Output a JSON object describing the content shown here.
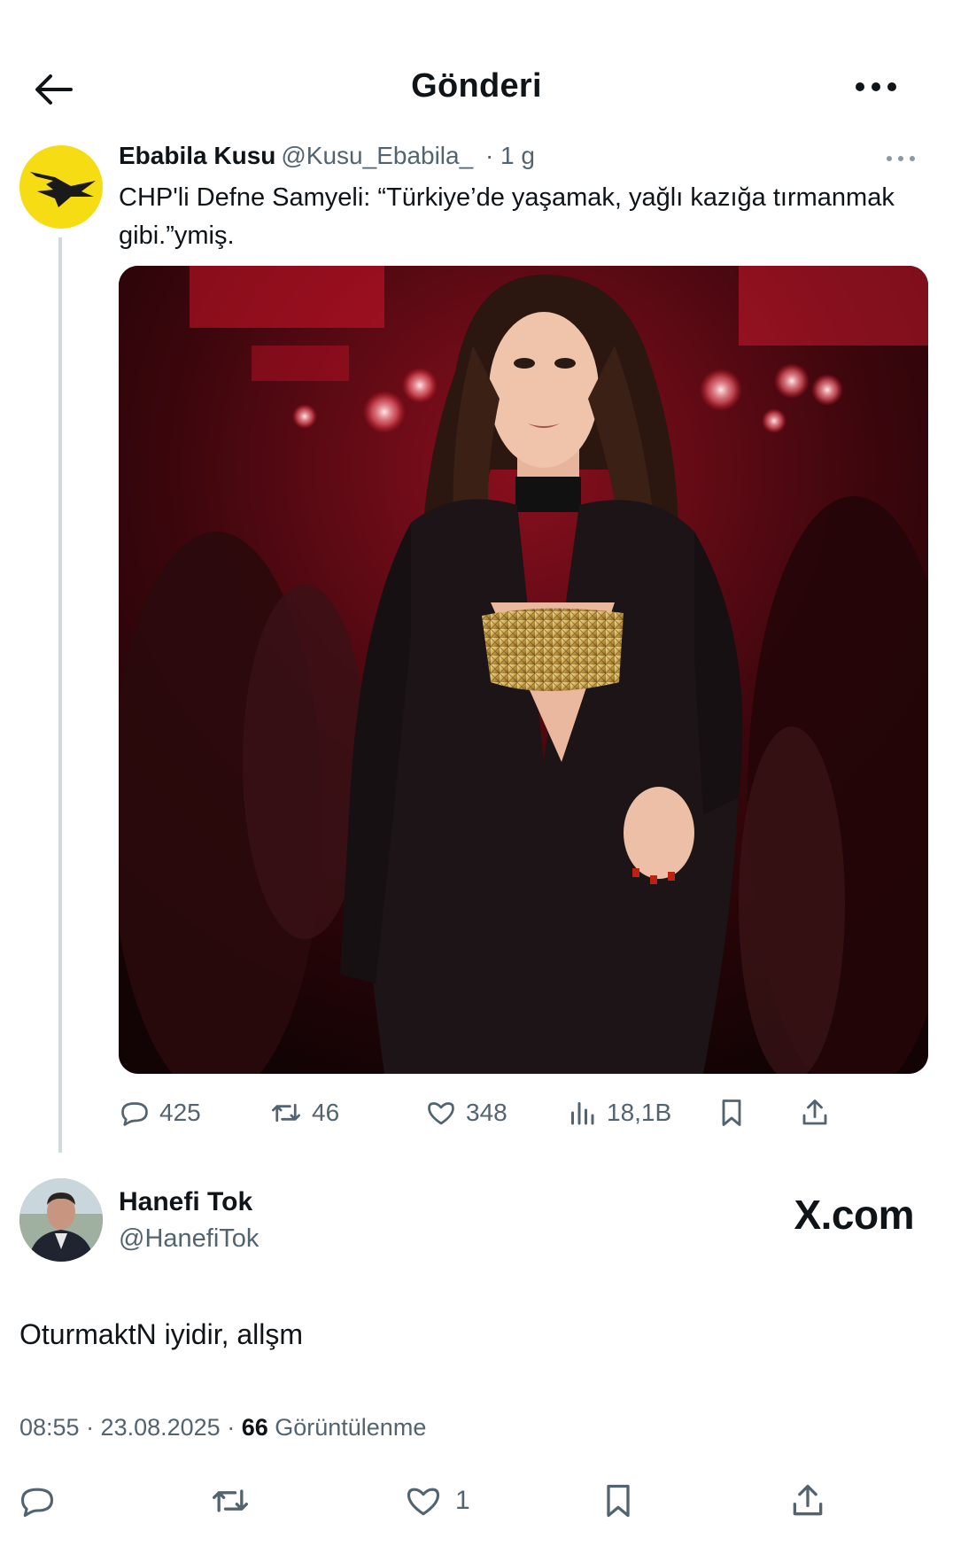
{
  "header": {
    "title": "Gönderi"
  },
  "quoted_post": {
    "author_name": "Ebabila Kusu",
    "author_handle": "@Kusu_Ebabila_",
    "time": "· 1 g",
    "text": "CHP'li Defne Samyeli: “Türkiye’de yaşamak, yağlı kazığa tırmanmak gibi.”ymiş.",
    "stats": {
      "replies": "425",
      "reposts": "46",
      "likes": "348",
      "views": "18,1B"
    }
  },
  "reply_post": {
    "author_name": "Hanefi Tok",
    "author_handle": "@HanefiTok",
    "watermark": "X.com",
    "text": "OturmaktN iyidir, allşm",
    "timestamp": "08:55 · 23.08.2025 · ",
    "views_count": "66",
    "views_label": " Görüntülenme",
    "likes": "1"
  },
  "colors": {
    "text": "#0f1419",
    "muted": "#536471",
    "thread_line": "#cfd9de",
    "avatar_yellow": "#f6dc13"
  },
  "icons": [
    "back-arrow-icon",
    "more-icon",
    "reply-icon",
    "repost-icon",
    "like-icon",
    "views-icon",
    "bookmark-icon",
    "share-icon"
  ]
}
